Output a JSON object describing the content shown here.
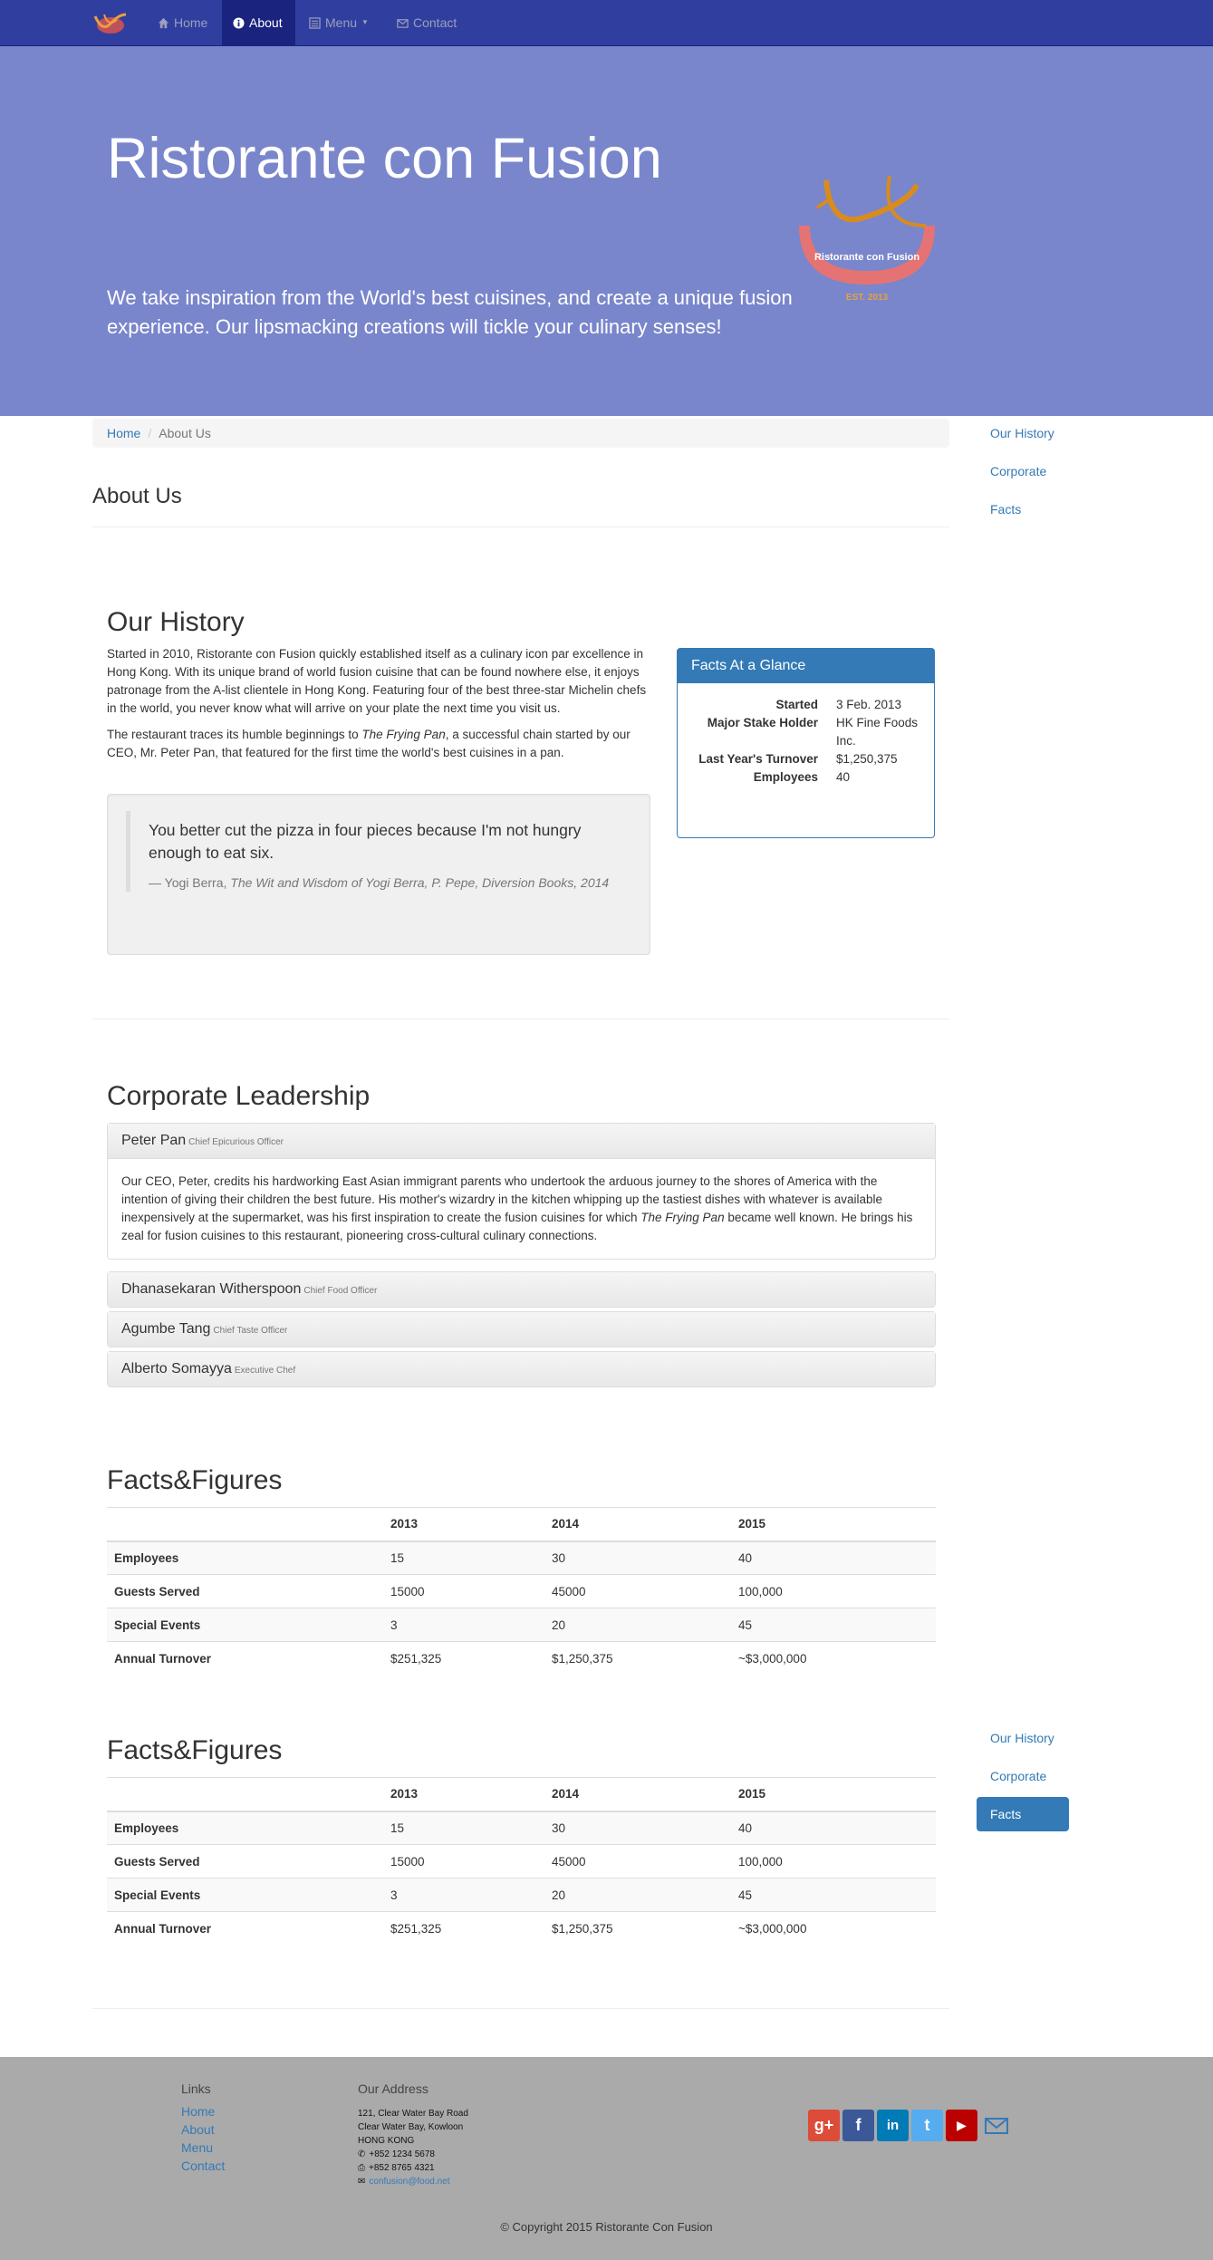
{
  "navbar": {
    "items": [
      {
        "label": "Home",
        "icon": "home-icon"
      },
      {
        "label": "About",
        "icon": "info-sign-icon"
      },
      {
        "label": "Menu",
        "icon": "list-alt-icon"
      },
      {
        "label": "Contact",
        "icon": "envelope-icon"
      }
    ],
    "brand_color": "#303F9F"
  },
  "jumbotron": {
    "title": "Ristorante con Fusion",
    "tagline": "We take inspiration from the World's best cuisines, and create a unique fusion experience. Our lipsmacking creations will tickle your culinary senses!",
    "logo_text": "Ristorante con Fusion",
    "logo_est": "EST. 2013",
    "bg_color": "#7986CB"
  },
  "breadcrumb": {
    "home": "Home",
    "current": "About Us"
  },
  "page_title": "About Us",
  "sidenav": {
    "items": [
      "Our History",
      "Corporate",
      "Facts"
    ],
    "active_index_bottom": 2
  },
  "history": {
    "heading": "Our History",
    "p1": "Started in 2010, Ristorante con Fusion quickly established itself as a culinary icon par excellence in Hong Kong. With its unique brand of world fusion cuisine that can be found nowhere else, it enjoys patronage from the A-list clientele in Hong Kong. Featuring four of the best three-star Michelin chefs in the world, you never know what will arrive on your plate the next time you visit us.",
    "p2_before": "The restaurant traces its humble beginnings to ",
    "p2_em": "The Frying Pan",
    "p2_after": ", a successful chain started by our CEO, Mr. Peter Pan, that featured for the first time the world's best cuisines in a pan.",
    "quote": "You better cut the pizza in four pieces because I'm not hungry enough to eat six.",
    "quote_by": "— Yogi Berra, ",
    "quote_source": "The Wit and Wisdom of Yogi Berra, P. Pepe, Diversion Books, 2014"
  },
  "facts_panel": {
    "title": "Facts At a Glance",
    "rows": [
      {
        "label": "Started",
        "value": "3 Feb. 2013"
      },
      {
        "label": "Major Stake Holder",
        "value": "HK Fine Foods Inc."
      },
      {
        "label": "Last Year's Turnover",
        "value": "$1,250,375"
      },
      {
        "label": "Employees",
        "value": "40"
      }
    ]
  },
  "corporate": {
    "heading": "Corporate Leadership",
    "leaders": [
      {
        "name": "Peter Pan",
        "role": "Chief Epicurious Officer"
      },
      {
        "name": "Dhanasekaran Witherspoon",
        "role": "Chief Food Officer"
      },
      {
        "name": "Agumbe Tang",
        "role": "Chief Taste Officer"
      },
      {
        "name": "Alberto Somayya",
        "role": "Executive Chef"
      }
    ],
    "bio_before": "Our CEO, Peter, credits his hardworking East Asian immigrant parents who undertook the arduous journey to the shores of America with the intention of giving their children the best future. His mother's wizardry in the kitchen whipping up the tastiest dishes with whatever is available inexpensively at the supermarket, was his first inspiration to create the fusion cuisines for which ",
    "bio_em": "The Frying Pan",
    "bio_after": " became well known. He brings his zeal for fusion cuisines to this restaurant, pioneering cross-cultural culinary connections."
  },
  "facts_table": {
    "heading": "Facts&Figures",
    "columns": [
      "",
      "2013",
      "2014",
      "2015"
    ],
    "rows": [
      [
        "Employees",
        "15",
        "30",
        "40"
      ],
      [
        "Guests Served",
        "15000",
        "45000",
        "100,000"
      ],
      [
        "Special Events",
        "3",
        "20",
        "45"
      ],
      [
        "Annual Turnover",
        "$251,325",
        "$1,250,375",
        "~$3,000,000"
      ]
    ]
  },
  "footer": {
    "links_heading": "Links",
    "links": [
      "Home",
      "About",
      "Menu",
      "Contact"
    ],
    "address_heading": "Our Address",
    "address": [
      "121, Clear Water Bay Road",
      "Clear Water Bay, Kowloon",
      "HONG KONG"
    ],
    "phone": "+852 1234 5678",
    "fax": "+852 8765 4321",
    "email": "confusion@food.net",
    "social": [
      {
        "icon": "google-plus-icon",
        "text": "g+",
        "color": "#dd4b39"
      },
      {
        "icon": "facebook-icon",
        "text": "f",
        "color": "#3b5998"
      },
      {
        "icon": "linkedin-icon",
        "text": "in",
        "color": "#007bb6"
      },
      {
        "icon": "twitter-icon",
        "text": "t",
        "color": "#55acee"
      },
      {
        "icon": "youtube-icon",
        "text": "▶",
        "color": "#bb0000"
      }
    ],
    "copyright": "© Copyright 2015 Ristorante Con Fusion"
  }
}
